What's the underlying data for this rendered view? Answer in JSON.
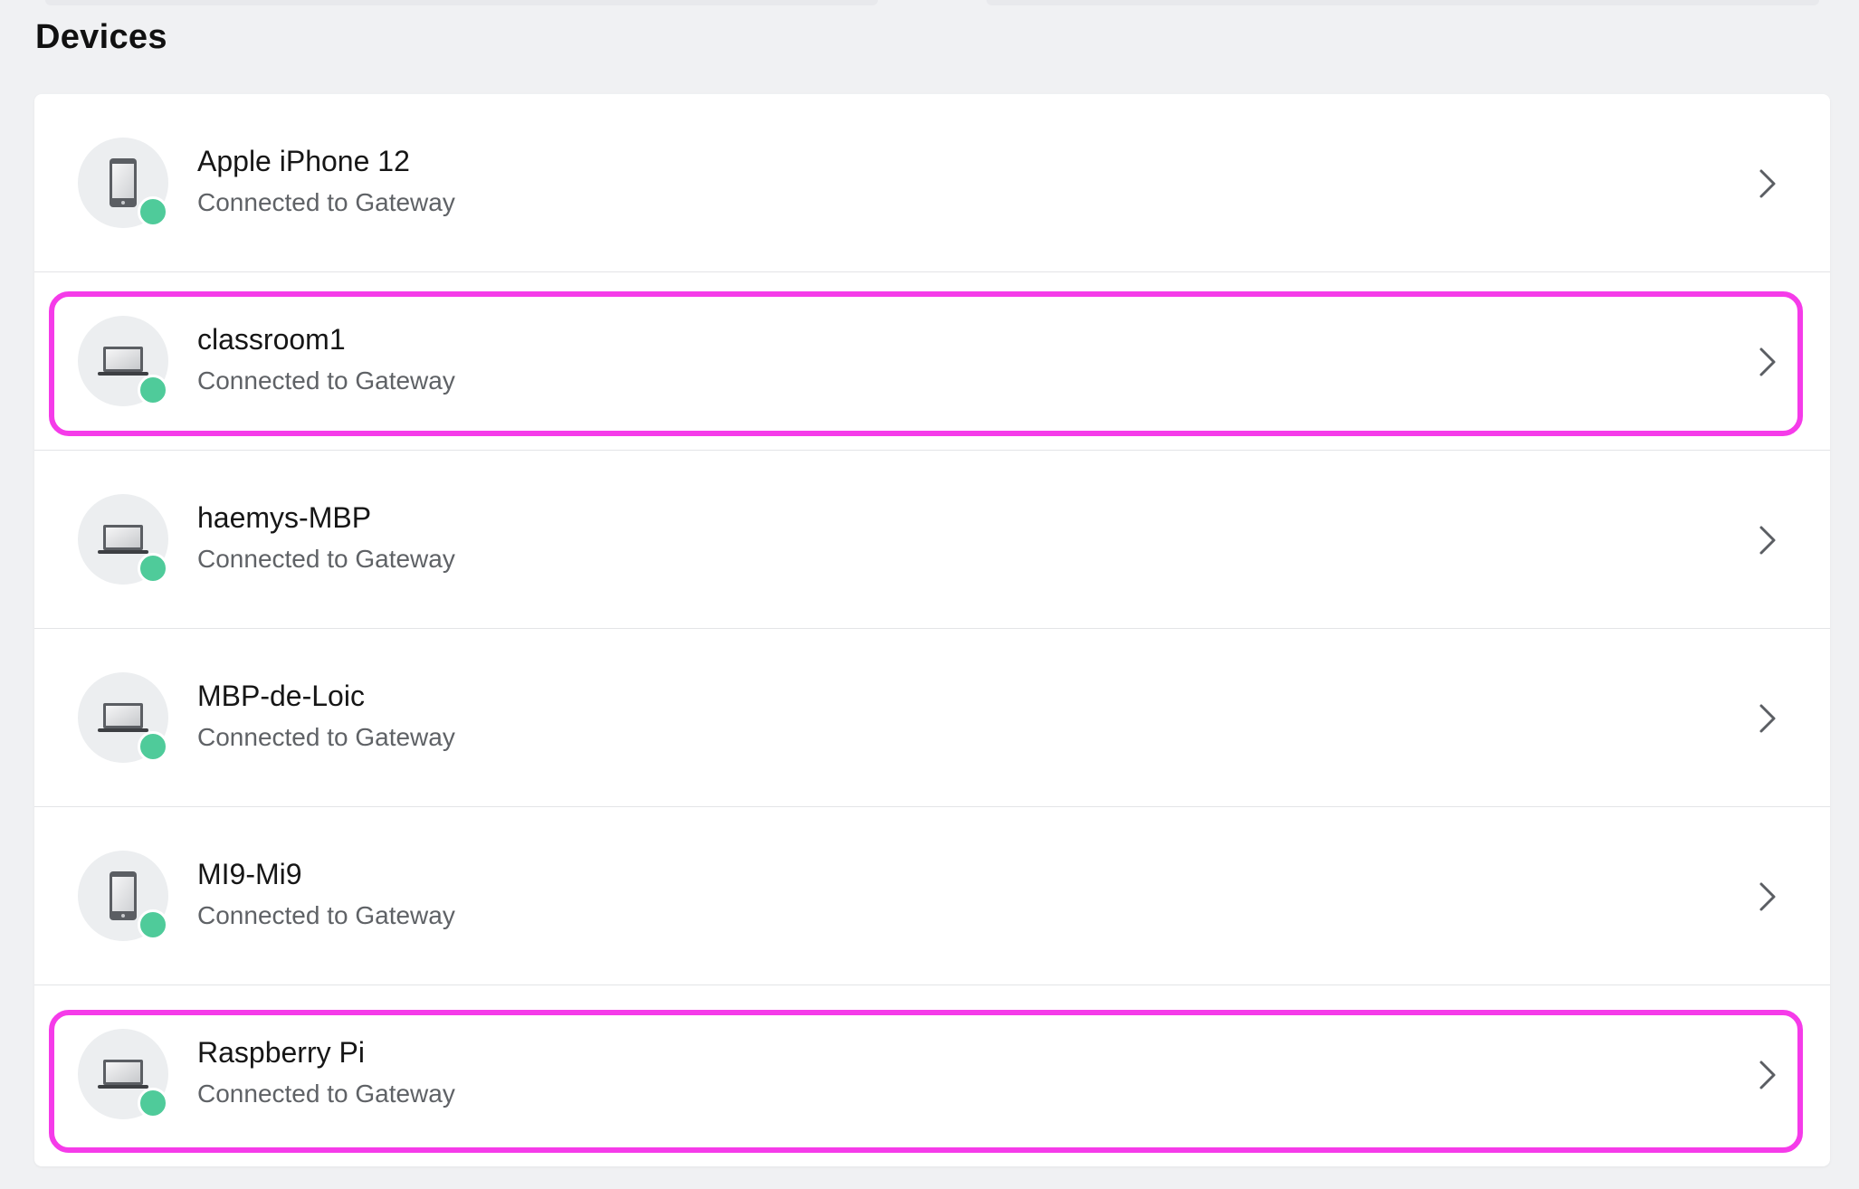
{
  "page": {
    "title": "Devices"
  },
  "colors": {
    "status_online": "#4fcb9a",
    "highlight": "#f53be9",
    "background": "#f0f1f3"
  },
  "devices": [
    {
      "name": "Apple iPhone 12",
      "status": "Connected to Gateway",
      "icon": "phone-icon",
      "highlighted": false
    },
    {
      "name": "classroom1",
      "status": "Connected to Gateway",
      "icon": "laptop-icon",
      "highlighted": true
    },
    {
      "name": "haemys-MBP",
      "status": "Connected to Gateway",
      "icon": "laptop-icon",
      "highlighted": false
    },
    {
      "name": "MBP-de-Loic",
      "status": "Connected to Gateway",
      "icon": "laptop-icon",
      "highlighted": false
    },
    {
      "name": "MI9-Mi9",
      "status": "Connected to Gateway",
      "icon": "phone-icon",
      "highlighted": false
    },
    {
      "name": "Raspberry Pi",
      "status": "Connected to Gateway",
      "icon": "laptop-icon",
      "highlighted": true
    }
  ]
}
